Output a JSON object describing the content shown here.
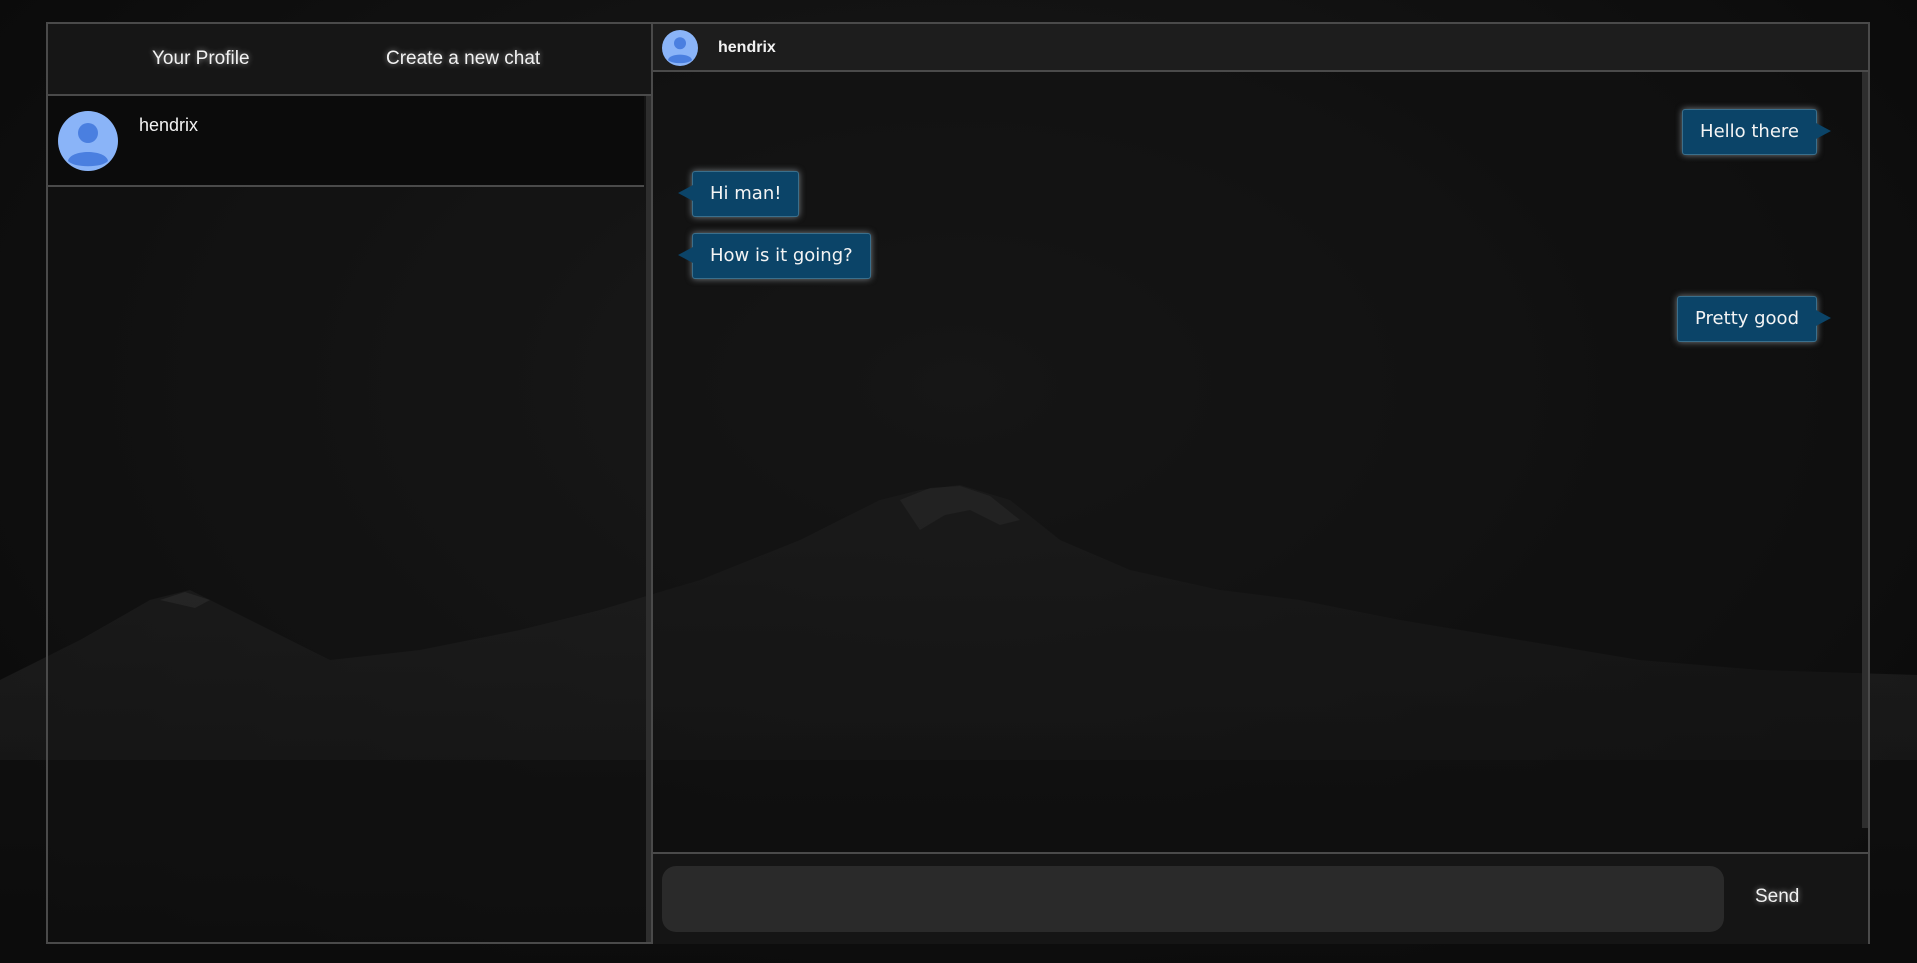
{
  "sidebar": {
    "header": {
      "profile_label": "Your Profile",
      "new_chat_label": "Create a new chat"
    },
    "chats": [
      {
        "name": "hendrix",
        "avatar_icon": "user-avatar-icon"
      }
    ]
  },
  "chat": {
    "header": {
      "name": "hendrix",
      "avatar_icon": "user-avatar-icon"
    },
    "messages": [
      {
        "text": "Hello there",
        "direction": "sent"
      },
      {
        "text": "Hi man!",
        "direction": "received"
      },
      {
        "text": "How is it going?",
        "direction": "received"
      },
      {
        "text": "Pretty good",
        "direction": "sent"
      }
    ],
    "composer": {
      "input_value": "",
      "input_placeholder": "",
      "send_label": "Send"
    }
  },
  "colors": {
    "bubble": "#0b4468",
    "border": "#4a4a4a",
    "avatar_bg": "#8ab4f8",
    "avatar_fg": "#4a7fe0"
  }
}
